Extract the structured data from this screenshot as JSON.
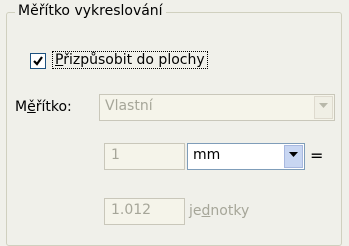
{
  "group": {
    "title": "Měřítko vykreslování"
  },
  "fit_to_page": {
    "label_prefix": "",
    "label_underlined": "P",
    "label_rest": "řizpůsobit do plochy",
    "checked": true
  },
  "scale": {
    "label_prefix": "M",
    "label_underlined": "ě",
    "label_rest": "řítko:",
    "value": "Vlastní"
  },
  "ratio": {
    "left_value": "1",
    "unit_value": "mm",
    "equals": "=",
    "right_value": "1.012",
    "units_label_prefix": "je",
    "units_label_underlined": "d",
    "units_label_rest": "notky"
  }
}
